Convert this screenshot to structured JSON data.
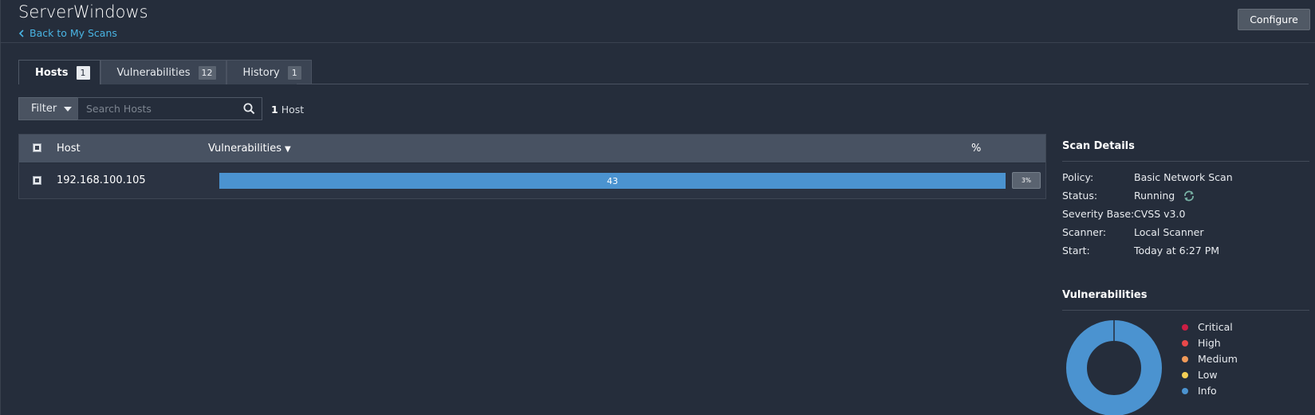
{
  "header": {
    "title": "ServerWindows",
    "back_link": "Back to My Scans",
    "configure_label": "Configure"
  },
  "tabs": [
    {
      "label": "Hosts",
      "count": "1",
      "active": true
    },
    {
      "label": "Vulnerabilities",
      "count": "12",
      "active": false
    },
    {
      "label": "History",
      "count": "1",
      "active": false
    }
  ],
  "filter": {
    "label": "Filter",
    "search_placeholder": "Search Hosts",
    "count_number": "1",
    "count_text": "Host"
  },
  "table": {
    "columns": {
      "host": "Host",
      "vulnerabilities": "Vulnerabilities",
      "percent": "%"
    },
    "sort_indicator": "▼",
    "rows": [
      {
        "host": "192.168.100.105",
        "vulnerabilities": "43",
        "percent": "3%",
        "info_fraction": 1.0
      }
    ]
  },
  "scan_details": {
    "title": "Scan Details",
    "items": [
      {
        "label": "Policy:",
        "value": "Basic Network Scan"
      },
      {
        "label": "Status:",
        "value": "Running"
      },
      {
        "label": "Severity Base:",
        "value": "CVSS v3.0"
      },
      {
        "label": "Scanner:",
        "value": "Local Scanner"
      },
      {
        "label": "Start:",
        "value": "Today at 6:27 PM"
      }
    ]
  },
  "vulnerabilities": {
    "title": "Vulnerabilities",
    "legend": [
      {
        "label": "Critical",
        "color": "#cc1e44"
      },
      {
        "label": "High",
        "color": "#e8484a"
      },
      {
        "label": "Medium",
        "color": "#f19a59"
      },
      {
        "label": "Low",
        "color": "#f5cf55"
      },
      {
        "label": "Info",
        "color": "#4b93d0"
      }
    ],
    "distribution": {
      "Critical": 0,
      "High": 0,
      "Medium": 0,
      "Low": 0,
      "Info": 43
    }
  },
  "colors": {
    "background": "#252d3b",
    "accent": "#49b4e3",
    "bar": "#4b93d0",
    "header_row": "#485262"
  },
  "icons": {
    "back": "chevron-left-icon",
    "search": "search-icon",
    "filter_caret": "caret-down-icon",
    "status": "spinner-icon"
  }
}
